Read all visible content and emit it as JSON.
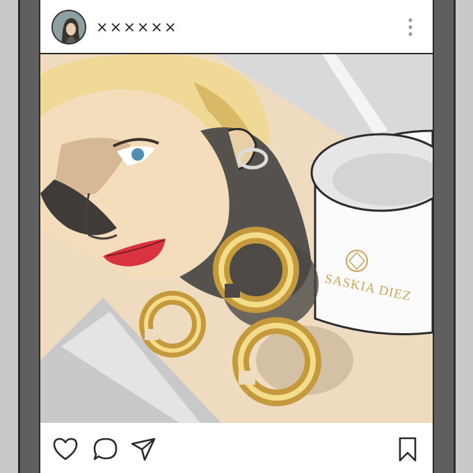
{
  "post": {
    "username": "××××××",
    "brand_text": "SASKIA DIEZ"
  },
  "icons": {
    "avatar": "profile-photo",
    "more": "vertical-ellipsis-icon",
    "like": "heart-icon",
    "comment": "speech-bubble-icon",
    "share": "paper-plane-icon",
    "save": "bookmark-icon"
  },
  "colors": {
    "frame": "#5f5f5f",
    "background": "#c9c9c9",
    "gold": "#c9a55a",
    "skin": "#f2dcb8",
    "lips": "#d8333f"
  }
}
